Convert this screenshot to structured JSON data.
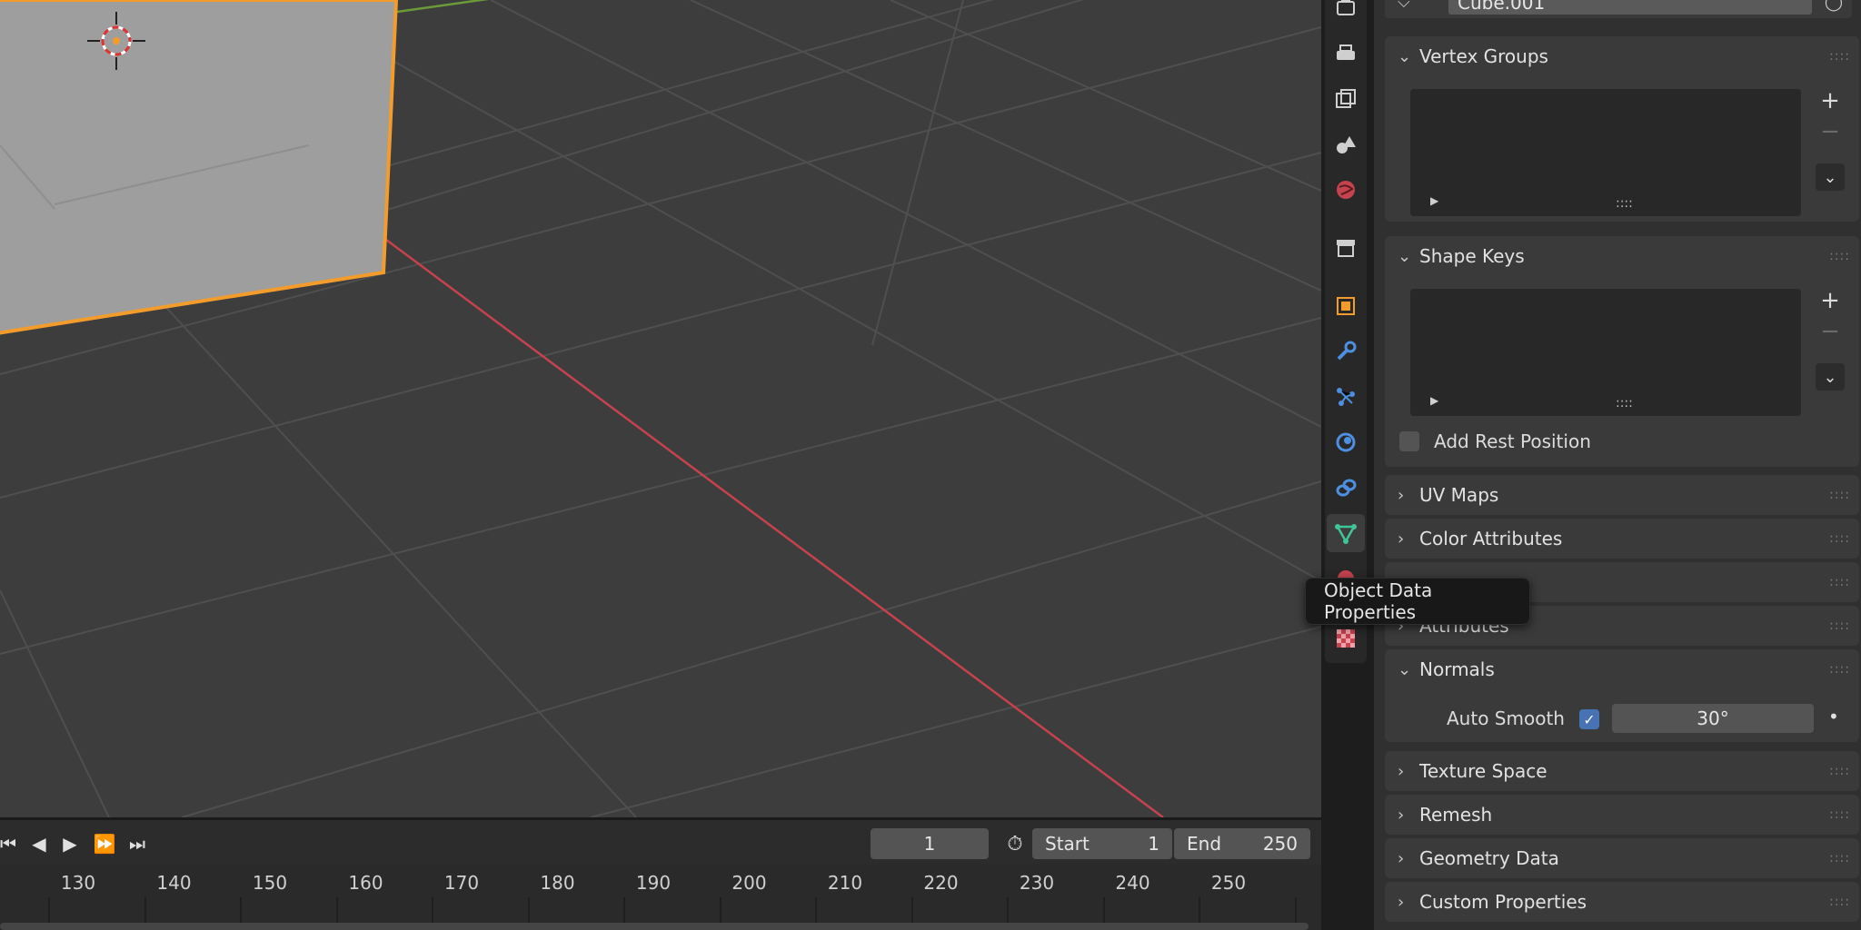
{
  "properties": {
    "datablock_name": "Cube.001",
    "tooltip": "Object Data Properties",
    "panels": {
      "vertex_groups": "Vertex Groups",
      "shape_keys": "Shape Keys",
      "add_rest_position": "Add Rest Position",
      "uv_maps": "UV Maps",
      "color_attributes": "Color Attributes",
      "attributes": "Attributes",
      "normals": "Normals",
      "auto_smooth_label": "Auto Smooth",
      "auto_smooth_angle": "30°",
      "texture_space": "Texture Space",
      "remesh": "Remesh",
      "geometry_data": "Geometry Data",
      "custom_properties": "Custom Properties"
    },
    "auto_smooth_checked": true
  },
  "timeline": {
    "current_frame": "1",
    "start_label": "Start",
    "start_value": "1",
    "end_label": "End",
    "end_value": "250",
    "ticks": [
      "130",
      "140",
      "150",
      "160",
      "170",
      "180",
      "190",
      "200",
      "210",
      "220",
      "230",
      "240",
      "250"
    ]
  },
  "colors": {
    "x_axis": "#c5424f",
    "y_axis": "#6b9a3a",
    "selection_outline": "#f39c2c",
    "active_tab_icon": "#3fc59a",
    "checkbox_blue": "#4772b3"
  },
  "icons": {
    "tabs": [
      "render-icon",
      "output-icon",
      "view-layer-icon",
      "scene-icon",
      "world-icon",
      "collection-icon",
      "object-icon",
      "modifier-icon",
      "particles-icon",
      "physics-icon",
      "constraints-icon",
      "object-data-icon",
      "material-icon",
      "texture-icon"
    ]
  }
}
